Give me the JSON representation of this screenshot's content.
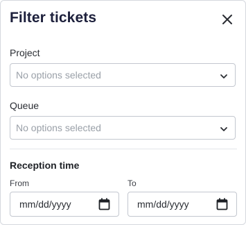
{
  "dialog": {
    "title": "Filter tickets",
    "close_icon": "close-icon"
  },
  "project": {
    "label": "Project",
    "placeholder": "No options selected",
    "icon": "chevron-down-icon"
  },
  "queue": {
    "label": "Queue",
    "placeholder": "No options selected",
    "icon": "chevron-down-icon"
  },
  "reception_time": {
    "title": "Reception time",
    "from": {
      "label": "From",
      "value": "mm/dd/yyyy",
      "icon": "calendar-icon"
    },
    "to": {
      "label": "To",
      "value": "mm/dd/yyyy",
      "icon": "calendar-icon"
    }
  },
  "colors": {
    "title": "#1c1f3b",
    "border": "#c3c7cf",
    "placeholder": "#9aa0a8"
  }
}
